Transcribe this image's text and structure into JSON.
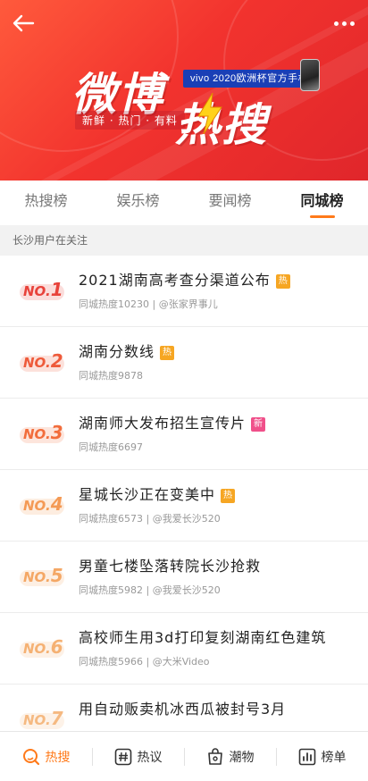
{
  "header": {
    "logo_left": "微博",
    "logo_right": "热搜",
    "tagline": "新鲜 · 热门 · 有料",
    "sponsor": "vivo 2020欧洲杯官方手机",
    "banner_color": "#f2332e"
  },
  "tabs": [
    {
      "label": "热搜榜",
      "active": false
    },
    {
      "label": "娱乐榜",
      "active": false
    },
    {
      "label": "要闻榜",
      "active": false
    },
    {
      "label": "同城榜",
      "active": true
    }
  ],
  "section_title": "长沙用户在关注",
  "items": [
    {
      "rank": "NO.",
      "num": "1",
      "title": "2021湖南高考查分渠道公布",
      "badge": "热",
      "meta": "同城热度10230 | @张家界事儿"
    },
    {
      "rank": "NO.",
      "num": "2",
      "title": "湖南分数线",
      "badge": "热",
      "meta": "同城热度9878"
    },
    {
      "rank": "NO.",
      "num": "3",
      "title": "湖南师大发布招生宣传片",
      "badge": "新",
      "meta": "同城热度6697"
    },
    {
      "rank": "NO.",
      "num": "4",
      "title": "星城长沙正在变美中",
      "badge": "热",
      "meta": "同城热度6573 | @我爱长沙520"
    },
    {
      "rank": "NO.",
      "num": "5",
      "title": "男童七楼坠落转院长沙抢救",
      "badge": "",
      "meta": "同城热度5982 | @我爱长沙520"
    },
    {
      "rank": "NO.",
      "num": "6",
      "title": "高校师生用3d打印复刻湖南红色建筑",
      "badge": "",
      "meta": "同城热度5966 | @大米Video"
    },
    {
      "rank": "NO.",
      "num": "7",
      "title": "用自动贩卖机冰西瓜被封号3月",
      "badge": "",
      "meta": ""
    }
  ],
  "badge_colors": {
    "热": "#f6a623",
    "新": "#f0508a"
  },
  "rank_colors": [
    "#e8423a",
    "#ee5a3a",
    "#f26d3c",
    "#f49a55",
    "#f4a765",
    "#f5b173",
    "#f5b981"
  ],
  "bottom_nav": [
    {
      "label": "热搜",
      "icon": "search-icon",
      "active": true
    },
    {
      "label": "热议",
      "icon": "hashtag-icon",
      "active": false
    },
    {
      "label": "潮物",
      "icon": "bag-icon",
      "active": false
    },
    {
      "label": "榜单",
      "icon": "chart-icon",
      "active": false
    }
  ]
}
